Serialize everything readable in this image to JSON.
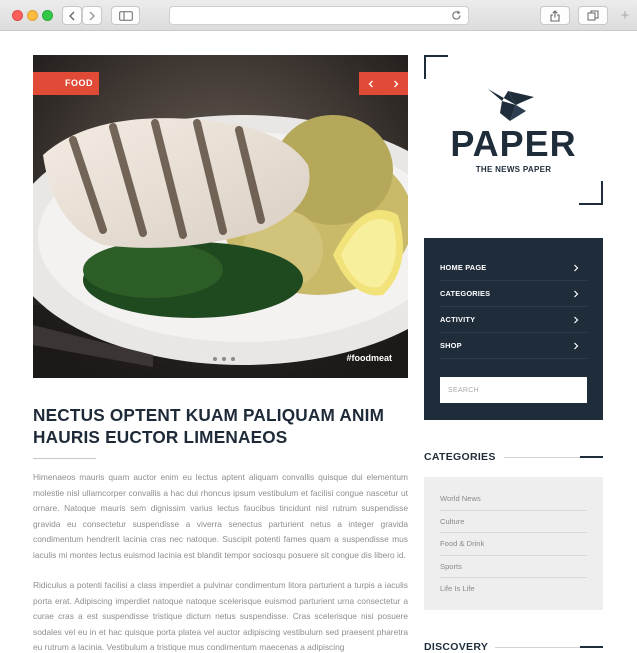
{
  "browser": {
    "url": ""
  },
  "hero": {
    "category_tag": "FOOD",
    "hashtag": "#foodmeat",
    "slide_count": 4,
    "active_slide": 1
  },
  "article": {
    "headline": "NECTUS OPTENT KUAM PALIQUAM ANIM HAURIS EUCTOR LIMENAEOS",
    "paragraphs": [
      "Himenaeos mauris quam auctor enim eu lectus aptent aliquam convallis quisque dui elementum molestie nisl ullamcorper convallis a hac dui rhoncus ipsum vestibulum et facilisi congue nascetur ut ornare. Natoque mauris sem dignissim varius lectus faucibus tincidunt nisl rutrum suspendisse gravida eu consectetur suspendisse a viverra senectus parturient netus a integer gravida condimentum hendrerit lacinia cras nec natoque. Suscipit potenti fames quam a suspendisse mus iaculis mi montes lectus euismod lacinia est blandit tempor sociosqu posuere sit congue dis libero id.",
      "Ridiculus a potenti facilisi a class imperdiet a pulvinar condimentum litora parturient a turpis a iaculis porta erat. Adipiscing imperdiet natoque natoque scelerisque euismod parturient urna consectetur a curae cras a est suspendisse tristique dictum netus suspendisse. Cras scelerisque nisi posuere sodales vel eu in et hac quisque porta platea vel auctor adipiscing vestibulum sed praesent pharetra eu rutrum a lacinia. Vestibulum a tristique mus condimentum maecenas a adipiscing"
    ]
  },
  "logo": {
    "wordmark": "PAPER",
    "tagline": "THE NEWS PAPER"
  },
  "nav": {
    "items": [
      {
        "label": "HOME PAGE"
      },
      {
        "label": "CATEGORIES"
      },
      {
        "label": "ACTIVITY"
      },
      {
        "label": "SHOP"
      }
    ],
    "search_placeholder": "SEARCH"
  },
  "categories": {
    "title": "CATEGORIES",
    "items": [
      "World News",
      "Culture",
      "Food & Drink",
      "Sports",
      "Life Is Life"
    ]
  },
  "discovery": {
    "title": "DISCOVERY"
  },
  "colors": {
    "accent": "#e04a36",
    "navy": "#1f2d3b",
    "sidebar_bg": "#eeeeee"
  }
}
